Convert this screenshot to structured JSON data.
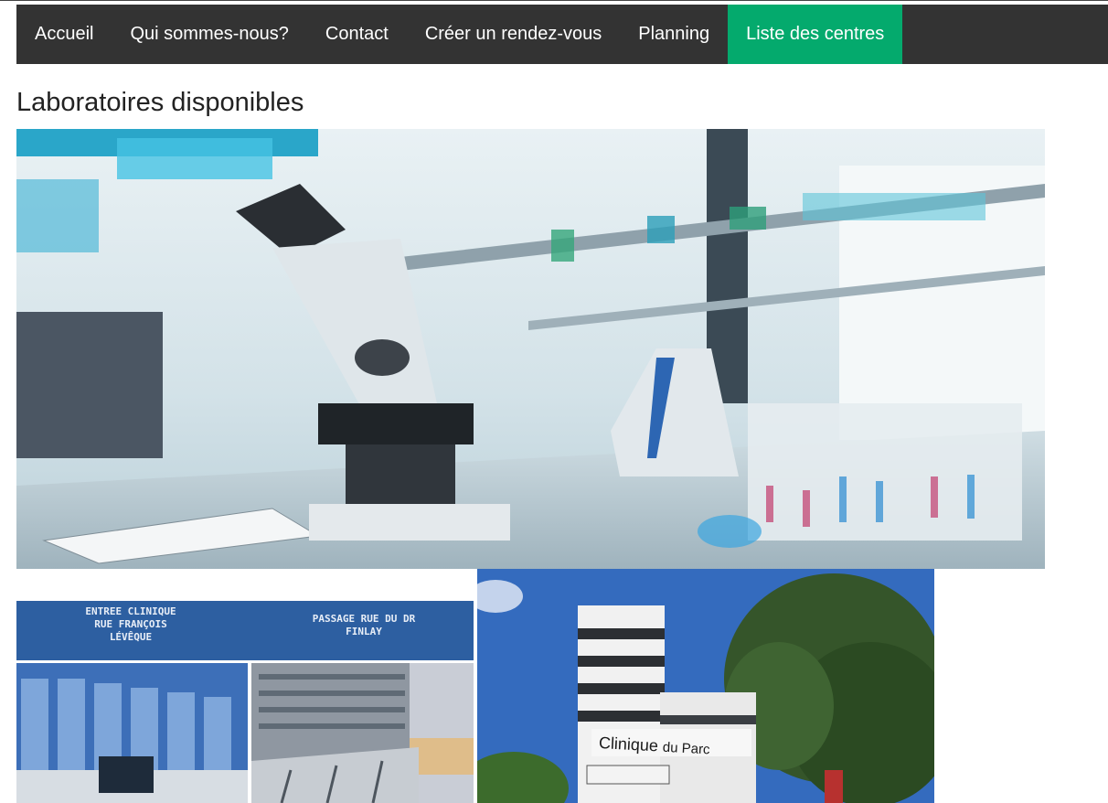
{
  "nav": {
    "items": [
      {
        "label": "Accueil",
        "active": false
      },
      {
        "label": "Qui sommes-nous?",
        "active": false
      },
      {
        "label": "Contact",
        "active": false
      },
      {
        "label": "Créer un rendez-vous",
        "active": false
      },
      {
        "label": "Planning",
        "active": false
      },
      {
        "label": "Liste des centres",
        "active": true
      }
    ],
    "background": "#333333",
    "active_color": "#04AA6D"
  },
  "main": {
    "title": "Laboratoires disponibles",
    "photos": [
      {
        "subject": "laboratory-microscope"
      },
      {
        "subject": "clinic-entrances",
        "caption_left": "ENTREE CLINIQUE\nRUE FRANÇOIS\nLÉVÊQUE",
        "caption_right": "PASSAGE RUE DU DR\nFINLAY"
      },
      {
        "subject": "clinique-du-parc",
        "sign_main": "Clinique",
        "sign_small": "du Parc"
      }
    ]
  }
}
